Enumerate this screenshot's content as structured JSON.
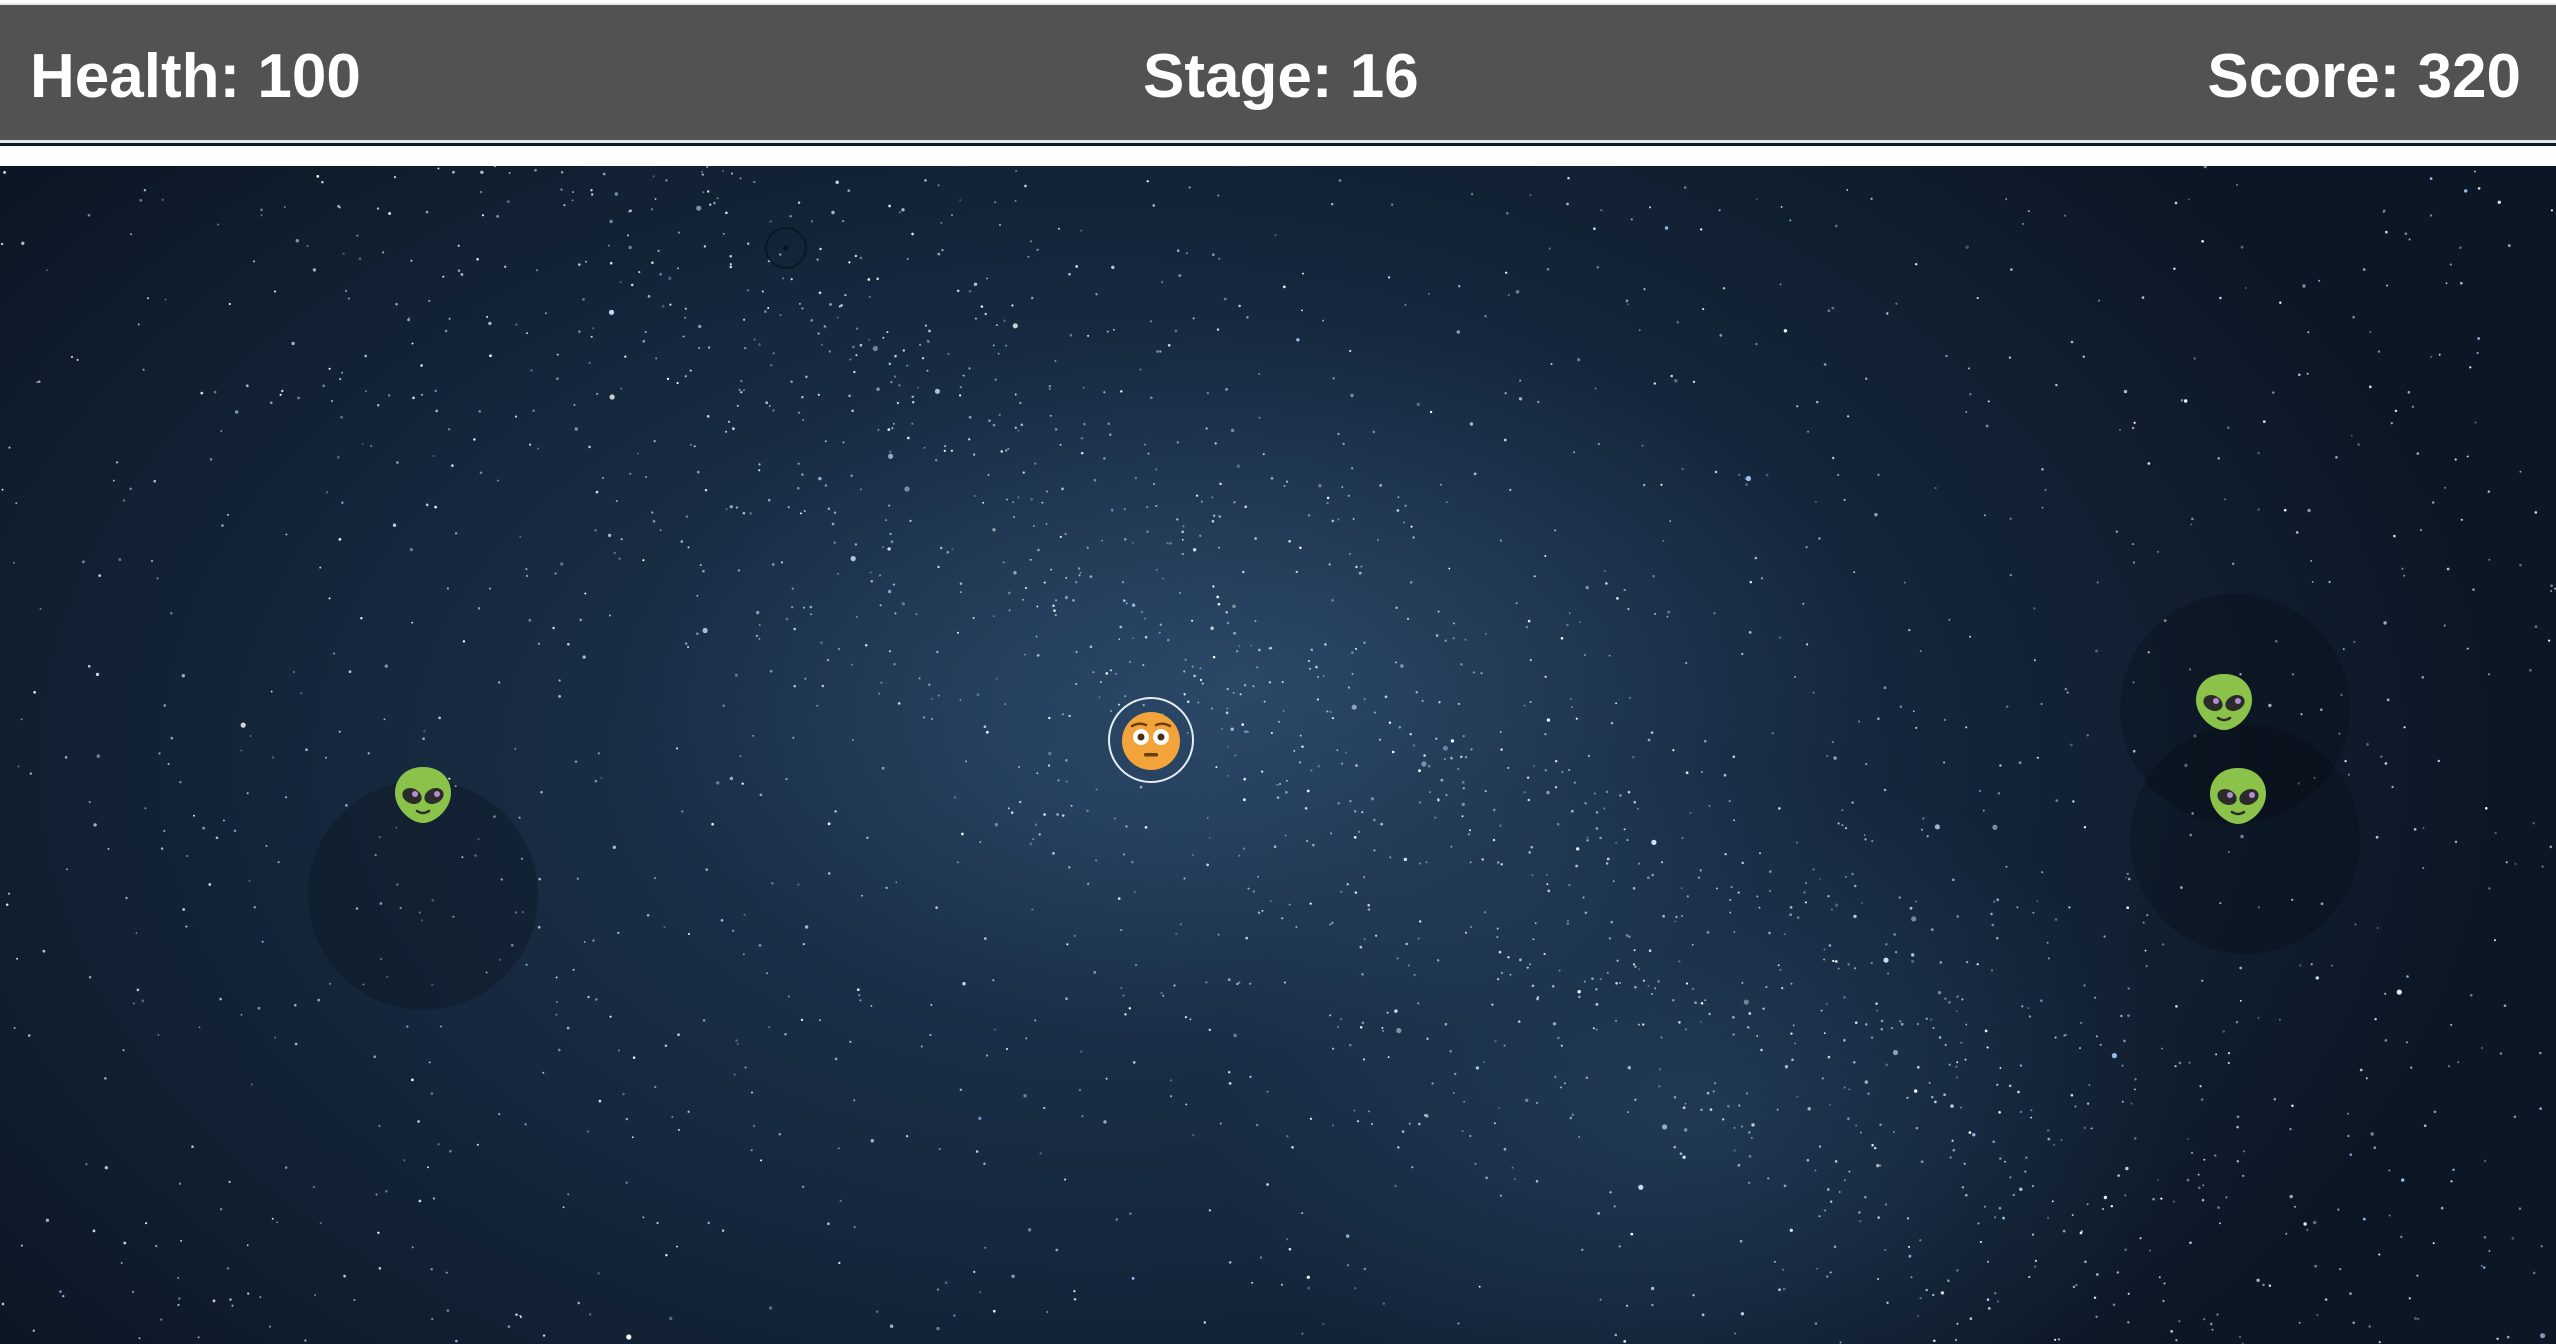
{
  "hud": {
    "health_text": "Health: 100",
    "stage_text": "Stage: 16",
    "score_text": "Score: 320",
    "background_color": "#525252",
    "text_color": "#ffffff"
  },
  "colors": {
    "space_dark": "#0c1725",
    "space_mid": "#1f3753",
    "alien_green": "#8bc34a",
    "player_orange": "#f2a33a"
  },
  "entities": {
    "player": {
      "icon": "flushed-face-icon"
    },
    "aliens": [
      {
        "icon": "alien-icon"
      },
      {
        "icon": "alien-icon"
      },
      {
        "icon": "alien-icon"
      }
    ],
    "pickup": {
      "icon": "target-ring-icon"
    }
  }
}
